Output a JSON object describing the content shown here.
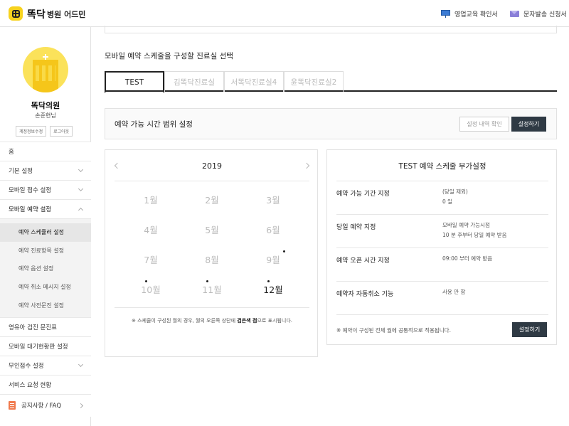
{
  "header": {
    "brand": "똑닥",
    "brand_sub": "병원 어드민",
    "links": [
      {
        "label": "영업교육 확인서",
        "icon": "easel-icon"
      },
      {
        "label": "문자발송 신청서",
        "icon": "mail-icon"
      }
    ]
  },
  "profile": {
    "clinic_name": "똑닥의원",
    "user_name": "손준현님",
    "edit_account": "계정정보수정",
    "logout": "로그아웃"
  },
  "sidebar": {
    "items_top": [
      {
        "label": "홈",
        "chevron": "none"
      },
      {
        "label": "기본 설정",
        "chevron": "down"
      },
      {
        "label": "모바일 접수 설정",
        "chevron": "down"
      },
      {
        "label": "모바일 예약 설정",
        "chevron": "up"
      }
    ],
    "sub_items": [
      {
        "label": "예약 스케쥴러 설정",
        "active": true
      },
      {
        "label": "예약 진료항목 설정",
        "active": false
      },
      {
        "label": "예약 옵션 설정",
        "active": false
      },
      {
        "label": "예약 취소 메시지 설정",
        "active": false
      },
      {
        "label": "예약 사전문진 설정",
        "active": false
      }
    ],
    "items_bottom": [
      {
        "label": "영유아 검진 문진표",
        "chevron": "none"
      },
      {
        "label": "모바일 대기현황판 설정",
        "chevron": "none"
      },
      {
        "label": "무인접수 설정",
        "chevron": "down"
      },
      {
        "label": "서비스 요청 현황",
        "chevron": "none"
      }
    ],
    "notice": {
      "label": "공지사항 / FAQ",
      "icon": "document-icon"
    }
  },
  "main": {
    "section_title": "모바일 예약 스케줄을 구성할 진료실 선택",
    "tabs": [
      {
        "label": "TEST",
        "active": true
      },
      {
        "label": "김똑닥진료실",
        "active": false
      },
      {
        "label": "서똑닥진료실4",
        "active": false
      },
      {
        "label": "윤똑닥진료실2",
        "active": false
      }
    ],
    "range": {
      "title": "예약 가능 시간 범위 설정",
      "history_button": "설정 내역 확인",
      "set_button": "설정하기"
    },
    "calendar": {
      "year": "2019",
      "months": [
        {
          "label": "1월",
          "dark": false,
          "dot": false
        },
        {
          "label": "2월",
          "dark": false,
          "dot": false
        },
        {
          "label": "3월",
          "dark": false,
          "dot": false
        },
        {
          "label": "4월",
          "dark": false,
          "dot": false
        },
        {
          "label": "5월",
          "dark": false,
          "dot": false
        },
        {
          "label": "6월",
          "dark": false,
          "dot": false
        },
        {
          "label": "7월",
          "dark": false,
          "dot": false
        },
        {
          "label": "8월",
          "dark": false,
          "dot": false
        },
        {
          "label": "9월",
          "dark": false,
          "dot": true
        },
        {
          "label": "10월",
          "dark": false,
          "dot": true
        },
        {
          "label": "11월",
          "dark": false,
          "dot": true
        },
        {
          "label": "12월",
          "dark": true,
          "dot": true
        }
      ],
      "note_before": "※ 스케줄이 구성된 월의 경우, 월의 오른쪽 상단에 ",
      "note_bold": "검은색 점",
      "note_after": "으로 표시됩니다."
    },
    "extra": {
      "title": "TEST 예약 스케줄 부가설정",
      "rows": [
        {
          "label": "예약 가능 기간 지정",
          "value_1": "(당일 제외)",
          "value_2": "0 일"
        },
        {
          "label": "당일 예약 지정",
          "value_1": "모바일 예약 가능시점",
          "value_2": "10 분 후부터 당일 예약 받음"
        },
        {
          "label": "예약 오픈 시간 지정",
          "value_1": "09:00 부터 예약 받음",
          "value_2": ""
        },
        {
          "label": "예약자 자동취소 기능",
          "value_1": "사용 안 함",
          "value_2": ""
        }
      ],
      "note": "※ 예약이 구성된 전체 월에 공통적으로 적용됩니다.",
      "set_button": "설정하기"
    }
  }
}
